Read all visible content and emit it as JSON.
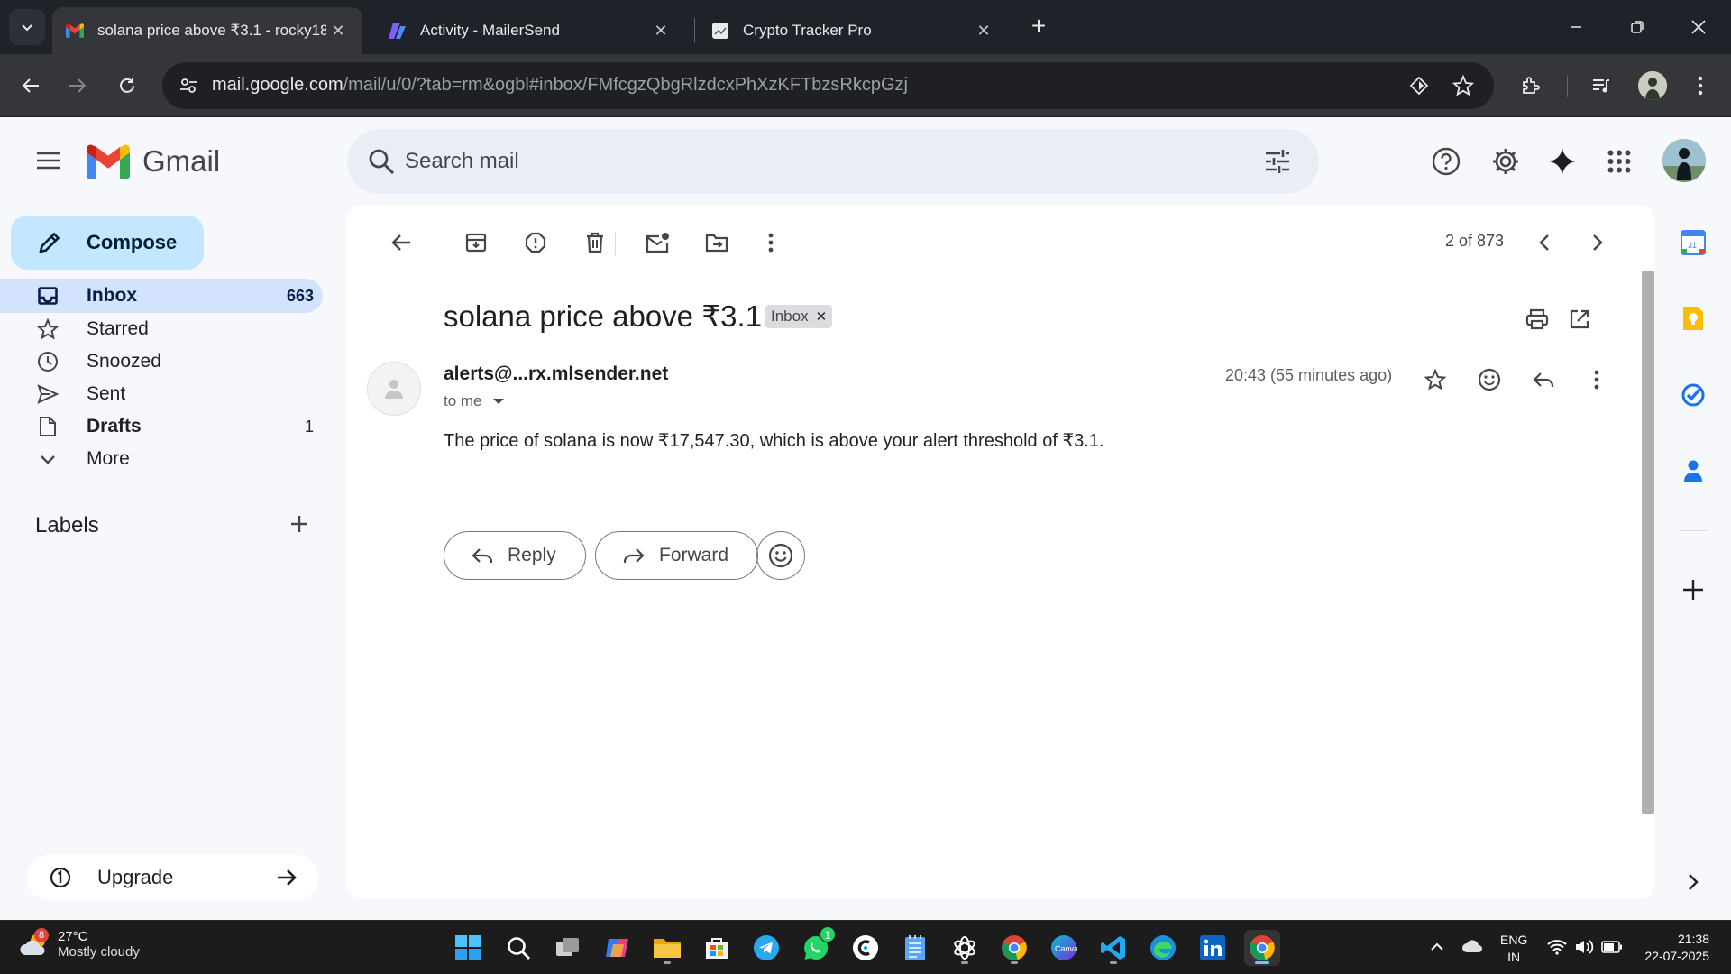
{
  "browser": {
    "tabs": [
      {
        "title": "solana price above ₹3.1 - rocky18",
        "icon": "gmail-icon",
        "active": true
      },
      {
        "title": "Activity - MailerSend",
        "icon": "mailersend-icon",
        "active": false
      },
      {
        "title": "Crypto Tracker Pro",
        "icon": "chart-icon",
        "active": false
      }
    ],
    "url_host": "mail.google.com",
    "url_path": "/mail/u/0/?tab=rm&ogbl#inbox/FMfcgzQbgRlzdcxPhXzKFTbzsRkcpGzj"
  },
  "gmail": {
    "brand": "Gmail",
    "search_placeholder": "Search mail",
    "compose_label": "Compose",
    "nav": [
      {
        "label": "Inbox",
        "count": "663",
        "icon": "inbox-icon"
      },
      {
        "label": "Starred",
        "count": "",
        "icon": "star-icon"
      },
      {
        "label": "Snoozed",
        "count": "",
        "icon": "clock-icon"
      },
      {
        "label": "Sent",
        "count": "",
        "icon": "send-icon"
      },
      {
        "label": "Drafts",
        "count": "1",
        "icon": "draft-icon"
      },
      {
        "label": "More",
        "count": "",
        "icon": "chevron-down-icon"
      }
    ],
    "labels_title": "Labels",
    "upgrade_label": "Upgrade"
  },
  "email": {
    "pager": "2 of 873",
    "subject": "solana price above ₹3.1",
    "label_chip": "Inbox",
    "sender": "alerts@...rx.mlsender.net",
    "recipient_line": "to me",
    "time": "20:43 (55 minutes ago)",
    "body": "The price of solana is now ₹17,547.30, which is above your alert threshold of ₹3.1.",
    "reply_label": "Reply",
    "forward_label": "Forward"
  },
  "taskbar": {
    "weather_badge": "8",
    "temperature": "27°C",
    "weather_desc": "Mostly cloudy",
    "whatsapp_badge": "1",
    "lang_line1": "ENG",
    "lang_line2": "IN",
    "time": "21:38",
    "date": "22-07-2025"
  },
  "colors": {
    "compose_bg": "#c2e7ff",
    "active_nav_bg": "#d3e3fd",
    "search_bg": "#e9eef6",
    "app_bg": "#f6f8fc"
  }
}
